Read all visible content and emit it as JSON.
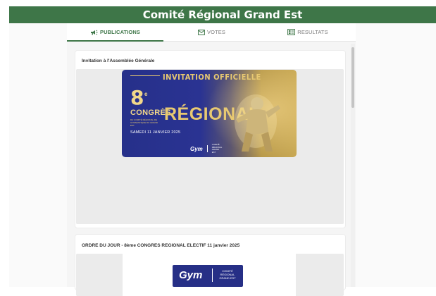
{
  "app": {
    "title": "Comité Régional Grand Est"
  },
  "tabs": [
    {
      "label": "PUBLICATIONS",
      "icon": "megaphone-icon",
      "active": true
    },
    {
      "label": "VOTES",
      "icon": "mail-icon",
      "active": false
    },
    {
      "label": "RESULTATS",
      "icon": "results-icon",
      "active": false
    }
  ],
  "publications": [
    {
      "title": "Invitation à l'Assemblée Générale",
      "poster": {
        "header": "INVITATION OFFICIELLE",
        "number": "8",
        "number_sup": "e",
        "congres": "CONGRÈS",
        "regional": "RÉGIONAL",
        "small_text": "DU COMITÉ RÉGIONAL DE GYMNASTIQUE DU GRAND EST",
        "date": "SAMEDI 11 JANVIER 2025",
        "logo_gym": "Gym",
        "logo_text": "COMITÉ RÉGIONAL GRAND EST"
      }
    },
    {
      "title": "ORDRE DU JOUR - 8ème CONGRES REGIONAL ELECTIF 11 janvier 2025",
      "logo": {
        "gym": "Gym",
        "text": "COMITÉ RÉGIONAL GRAND EST"
      }
    }
  ],
  "colors": {
    "header_bg": "#3e7648",
    "accent": "#3e7648",
    "poster_blue": "#26308a",
    "poster_gold": "#e8c971"
  }
}
